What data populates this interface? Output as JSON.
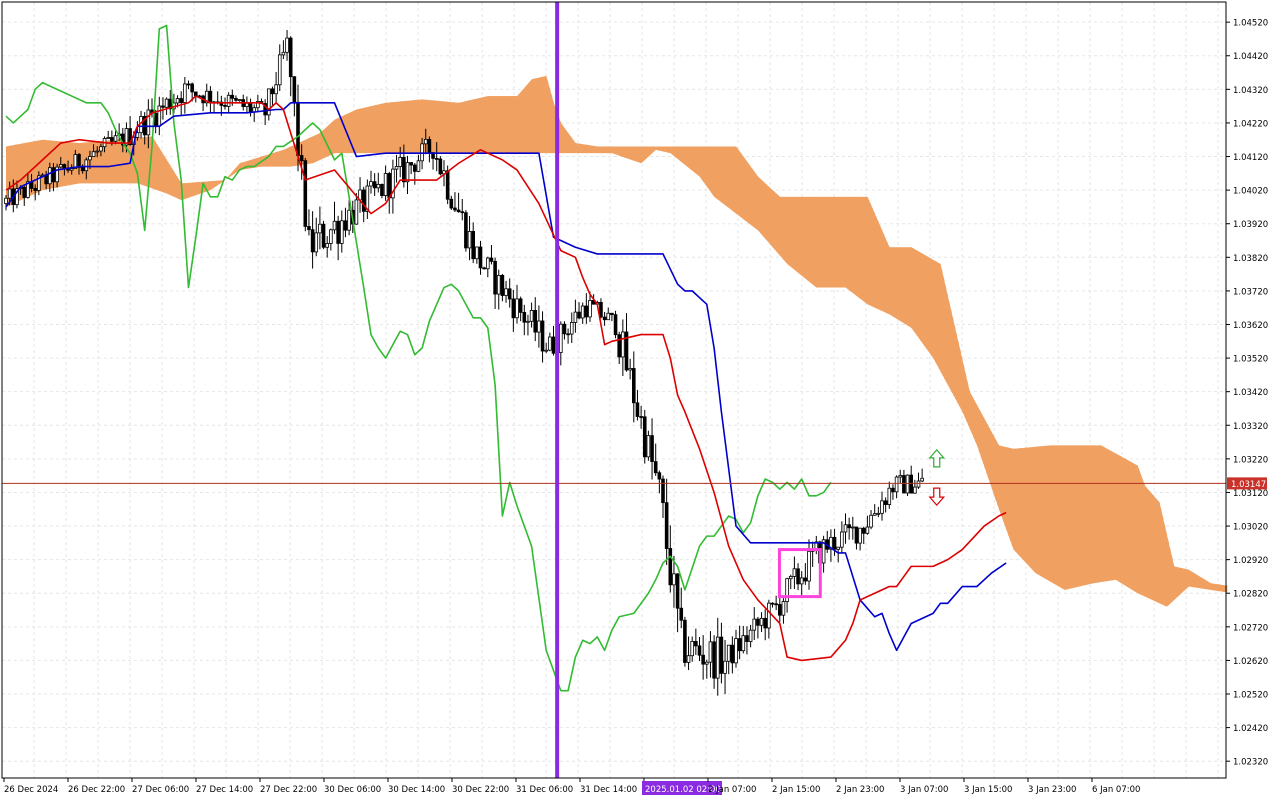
{
  "chart_data": {
    "type": "candlestick",
    "price_axis": {
      "range": [
        1.0227,
        1.0458
      ],
      "ticks": [
        "1.04520",
        "1.04420",
        "1.04320",
        "1.04220",
        "1.04120",
        "1.04020",
        "1.03920",
        "1.03820",
        "1.03720",
        "1.03620",
        "1.03520",
        "1.03420",
        "1.03320",
        "1.03220",
        "1.03120",
        "1.03020",
        "1.02920",
        "1.02820",
        "1.02720",
        "1.02620",
        "1.02520",
        "1.02420",
        "1.02320"
      ]
    },
    "time_axis": {
      "labels": [
        "26 Dec 2024",
        "26 Dec 22:00",
        "27 Dec 06:00",
        "27 Dec 14:00",
        "27 Dec 22:00",
        "30 Dec 06:00",
        "30 Dec 14:00",
        "30 Dec 22:00",
        "31 Dec 06:00",
        "31 Dec 14:00",
        "2025.01.02 02:00",
        "2 Jan 07:00",
        "2 Jan 15:00",
        "2 Jan 23:00",
        "3 Jan 07:00",
        "3 Jan 15:00",
        "3 Jan 23:00",
        "6 Jan 07:00"
      ],
      "highlighted_label": "2025.01.02 02:00"
    },
    "current_price": "1.03147",
    "grid": true,
    "colors": {
      "bull_body": "#ffffff",
      "bear_body": "#000000",
      "tenkan": "#dd0000",
      "kijun": "#0000cc",
      "chikou": "#33bb33",
      "kumo_up": "#f0a060",
      "kumo_down": "#d2bcd8",
      "current_line": "#b03020",
      "marker_line": "#8a2be2",
      "box": "#ff44dd",
      "arrow_up": "#33aa33",
      "arrow_down": "#dd0000"
    },
    "tenkan": [
      [
        0,
        1.0402
      ],
      [
        4,
        1.0405
      ],
      [
        10,
        1.0411
      ],
      [
        15,
        1.0416
      ],
      [
        20,
        1.0417
      ],
      [
        28,
        1.0416
      ],
      [
        34,
        1.0416
      ],
      [
        36,
        1.0421
      ],
      [
        40,
        1.0425
      ],
      [
        50,
        1.0428
      ],
      [
        52,
        1.043
      ],
      [
        56,
        1.0428
      ],
      [
        60,
        1.0428
      ],
      [
        70,
        1.0428
      ],
      [
        72,
        1.0426
      ],
      [
        74,
        1.0428
      ],
      [
        76,
        1.0426
      ],
      [
        82,
        1.0405
      ],
      [
        90,
        1.0408
      ],
      [
        100,
        1.0395
      ],
      [
        104,
        1.0398
      ],
      [
        108,
        1.0405
      ],
      [
        110,
        1.0405
      ],
      [
        118,
        1.0405
      ],
      [
        124,
        1.041
      ],
      [
        130,
        1.0414
      ],
      [
        136,
        1.0411
      ],
      [
        140,
        1.0408
      ],
      [
        146,
        1.0398
      ],
      [
        152,
        1.0384
      ],
      [
        156,
        1.0382
      ],
      [
        158,
        1.0376
      ],
      [
        160,
        1.0371
      ],
      [
        162,
        1.0368
      ],
      [
        164,
        1.0356
      ],
      [
        166,
        1.0357
      ],
      [
        170,
        1.0358
      ],
      [
        174,
        1.0359
      ],
      [
        180,
        1.0359
      ],
      [
        182,
        1.0352
      ],
      [
        184,
        1.0341
      ],
      [
        186,
        1.0336
      ],
      [
        190,
        1.0325
      ],
      [
        194,
        1.0312
      ],
      [
        198,
        1.0296
      ],
      [
        202,
        1.0286
      ],
      [
        206,
        1.028
      ],
      [
        212,
        1.0273
      ],
      [
        214,
        1.0263
      ],
      [
        218,
        1.0262
      ],
      [
        226,
        1.0263
      ],
      [
        230,
        1.0268
      ],
      [
        232,
        1.0273
      ],
      [
        234,
        1.028
      ],
      [
        238,
        1.0282
      ],
      [
        242,
        1.0284
      ],
      [
        244,
        1.0284
      ],
      [
        246,
        1.0287
      ],
      [
        248,
        1.029
      ],
      [
        254,
        1.029
      ],
      [
        258,
        1.0292
      ],
      [
        262,
        1.0295
      ],
      [
        268,
        1.0302
      ],
      [
        272,
        1.0305
      ],
      [
        274,
        1.0306
      ]
    ],
    "kijun": [
      [
        0,
        1.0397
      ],
      [
        4,
        1.0403
      ],
      [
        14,
        1.0408
      ],
      [
        20,
        1.0409
      ],
      [
        28,
        1.0409
      ],
      [
        34,
        1.041
      ],
      [
        36,
        1.0421
      ],
      [
        42,
        1.0421
      ],
      [
        46,
        1.0424
      ],
      [
        56,
        1.0425
      ],
      [
        66,
        1.0425
      ],
      [
        74,
        1.0426
      ],
      [
        76,
        1.0426
      ],
      [
        78,
        1.0428
      ],
      [
        84,
        1.0428
      ],
      [
        90,
        1.0428
      ],
      [
        96,
        1.0412
      ],
      [
        104,
        1.0413
      ],
      [
        116,
        1.0413
      ],
      [
        130,
        1.0413
      ],
      [
        138,
        1.0413
      ],
      [
        146,
        1.0413
      ],
      [
        150,
        1.0388
      ],
      [
        156,
        1.0385
      ],
      [
        162,
        1.0383
      ],
      [
        168,
        1.0383
      ],
      [
        176,
        1.0383
      ],
      [
        178,
        1.0383
      ],
      [
        180,
        1.0383
      ],
      [
        184,
        1.0374
      ],
      [
        186,
        1.0372
      ],
      [
        188,
        1.0372
      ],
      [
        192,
        1.0368
      ],
      [
        194,
        1.0355
      ],
      [
        196,
        1.0336
      ],
      [
        198,
        1.0319
      ],
      [
        200,
        1.0302
      ],
      [
        204,
        1.0297
      ],
      [
        214,
        1.0297
      ],
      [
        224,
        1.0297
      ],
      [
        228,
        1.0294
      ],
      [
        230,
        1.0294
      ],
      [
        234,
        1.028
      ],
      [
        238,
        1.0275
      ],
      [
        240,
        1.0276
      ],
      [
        242,
        1.027
      ],
      [
        244,
        1.0265
      ],
      [
        248,
        1.0273
      ],
      [
        254,
        1.0276
      ],
      [
        256,
        1.0279
      ],
      [
        258,
        1.0279
      ],
      [
        262,
        1.0284
      ],
      [
        266,
        1.0284
      ],
      [
        270,
        1.0288
      ],
      [
        274,
        1.0291
      ]
    ],
    "chikou": [
      [
        0,
        1.0424
      ],
      [
        2,
        1.0422
      ],
      [
        6,
        1.0426
      ],
      [
        8,
        1.0432
      ],
      [
        10,
        1.0434
      ],
      [
        14,
        1.0432
      ],
      [
        18,
        1.043
      ],
      [
        22,
        1.0428
      ],
      [
        26,
        1.0428
      ],
      [
        28,
        1.0425
      ],
      [
        30,
        1.042
      ],
      [
        32,
        1.0416
      ],
      [
        34,
        1.0413
      ],
      [
        36,
        1.0407
      ],
      [
        38,
        1.039
      ],
      [
        40,
        1.0415
      ],
      [
        42,
        1.045
      ],
      [
        44,
        1.0451
      ],
      [
        46,
        1.0422
      ],
      [
        48,
        1.0405
      ],
      [
        50,
        1.0373
      ],
      [
        52,
        1.0388
      ],
      [
        54,
        1.0404
      ],
      [
        56,
        1.04
      ],
      [
        58,
        1.04
      ],
      [
        60,
        1.0406
      ],
      [
        62,
        1.0405
      ],
      [
        64,
        1.0408
      ],
      [
        66,
        1.0409
      ],
      [
        68,
        1.0409
      ],
      [
        72,
        1.0412
      ],
      [
        74,
        1.0415
      ],
      [
        76,
        1.0415
      ],
      [
        80,
        1.0418
      ],
      [
        84,
        1.0422
      ],
      [
        86,
        1.042
      ],
      [
        90,
        1.0411
      ],
      [
        92,
        1.0413
      ],
      [
        94,
        1.04
      ],
      [
        98,
        1.0373
      ],
      [
        100,
        1.0359
      ],
      [
        102,
        1.0355
      ],
      [
        104,
        1.0352
      ],
      [
        106,
        1.0356
      ],
      [
        108,
        1.036
      ],
      [
        110,
        1.0359
      ],
      [
        112,
        1.0353
      ],
      [
        114,
        1.0355
      ],
      [
        116,
        1.0363
      ],
      [
        118,
        1.0368
      ],
      [
        120,
        1.0373
      ],
      [
        122,
        1.0374
      ],
      [
        124,
        1.0372
      ],
      [
        126,
        1.0368
      ],
      [
        128,
        1.0364
      ],
      [
        130,
        1.0364
      ],
      [
        132,
        1.0361
      ],
      [
        134,
        1.0344
      ],
      [
        136,
        1.0305
      ],
      [
        138,
        1.0315
      ],
      [
        140,
        1.0308
      ],
      [
        144,
        1.0296
      ],
      [
        148,
        1.0265
      ],
      [
        152,
        1.0253
      ],
      [
        154,
        1.0253
      ],
      [
        156,
        1.0263
      ],
      [
        158,
        1.0268
      ],
      [
        160,
        1.0267
      ],
      [
        162,
        1.0269
      ],
      [
        164,
        1.0265
      ],
      [
        166,
        1.0271
      ],
      [
        168,
        1.0275
      ],
      [
        172,
        1.0276
      ],
      [
        176,
        1.0282
      ],
      [
        178,
        1.0286
      ],
      [
        180,
        1.0291
      ],
      [
        182,
        1.0293
      ],
      [
        184,
        1.029
      ],
      [
        186,
        1.0283
      ],
      [
        190,
        1.0296
      ],
      [
        192,
        1.0299
      ],
      [
        194,
        1.0299
      ],
      [
        196,
        1.0302
      ],
      [
        198,
        1.0305
      ],
      [
        200,
        1.0304
      ],
      [
        202,
        1.03
      ],
      [
        204,
        1.0303
      ],
      [
        206,
        1.0311
      ],
      [
        208,
        1.0316
      ],
      [
        210,
        1.0315
      ],
      [
        212,
        1.0313
      ],
      [
        214,
        1.0315
      ],
      [
        216,
        1.0313
      ],
      [
        218,
        1.0316
      ],
      [
        220,
        1.0311
      ],
      [
        222,
        1.0311
      ],
      [
        224,
        1.0312
      ],
      [
        226,
        1.0315
      ]
    ],
    "kumo_a": [
      [
        0,
        1.0415
      ],
      [
        10,
        1.0417
      ],
      [
        20,
        1.0416
      ],
      [
        40,
        1.0418
      ],
      [
        48,
        1.0404
      ],
      [
        60,
        1.0405
      ],
      [
        64,
        1.041
      ],
      [
        76,
        1.0414
      ],
      [
        80,
        1.0416
      ],
      [
        86,
        1.0419
      ],
      [
        90,
        1.0423
      ],
      [
        96,
        1.0426
      ],
      [
        104,
        1.0428
      ],
      [
        114,
        1.0429
      ],
      [
        124,
        1.0428
      ],
      [
        132,
        1.043
      ],
      [
        140,
        1.043
      ],
      [
        144,
        1.0435
      ],
      [
        148,
        1.0436
      ],
      [
        150,
        1.0428
      ],
      [
        152,
        1.0422
      ],
      [
        156,
        1.0416
      ],
      [
        162,
        1.0415
      ],
      [
        166,
        1.0415
      ],
      [
        174,
        1.0415
      ],
      [
        184,
        1.0415
      ],
      [
        192,
        1.0415
      ],
      [
        200,
        1.0415
      ],
      [
        206,
        1.0406
      ],
      [
        212,
        1.04
      ],
      [
        216,
        1.04
      ],
      [
        226,
        1.04
      ],
      [
        236,
        1.04
      ],
      [
        242,
        1.0385
      ],
      [
        248,
        1.0385
      ],
      [
        256,
        1.038
      ],
      [
        264,
        1.0342
      ],
      [
        272,
        1.0326
      ],
      [
        276,
        1.0325
      ],
      [
        286,
        1.0326
      ],
      [
        300,
        1.0326
      ],
      [
        310,
        1.032
      ],
      [
        312,
        1.0314
      ],
      [
        316,
        1.0309
      ],
      [
        320,
        1.029
      ],
      [
        324,
        1.0289
      ],
      [
        330,
        1.0285
      ],
      [
        336,
        1.0284
      ]
    ],
    "kumo_b": [
      [
        0,
        1.0397
      ],
      [
        10,
        1.0402
      ],
      [
        20,
        1.0404
      ],
      [
        36,
        1.0404
      ],
      [
        44,
        1.0401
      ],
      [
        48,
        1.0399
      ],
      [
        56,
        1.0402
      ],
      [
        60,
        1.0405
      ],
      [
        64,
        1.0408
      ],
      [
        70,
        1.0409
      ],
      [
        78,
        1.0409
      ],
      [
        84,
        1.041
      ],
      [
        90,
        1.0413
      ],
      [
        100,
        1.0413
      ],
      [
        116,
        1.0413
      ],
      [
        124,
        1.0413
      ],
      [
        130,
        1.0413
      ],
      [
        140,
        1.0413
      ],
      [
        146,
        1.0413
      ],
      [
        150,
        1.0413
      ],
      [
        156,
        1.0413
      ],
      [
        160,
        1.0413
      ],
      [
        166,
        1.0413
      ],
      [
        174,
        1.041
      ],
      [
        178,
        1.0414
      ],
      [
        182,
        1.0413
      ],
      [
        190,
        1.0406
      ],
      [
        194,
        1.04
      ],
      [
        200,
        1.0395
      ],
      [
        206,
        1.039
      ],
      [
        214,
        1.038
      ],
      [
        222,
        1.0373
      ],
      [
        230,
        1.0373
      ],
      [
        236,
        1.0368
      ],
      [
        242,
        1.0365
      ],
      [
        248,
        1.0361
      ],
      [
        254,
        1.0352
      ],
      [
        258,
        1.0344
      ],
      [
        262,
        1.0336
      ],
      [
        266,
        1.0326
      ],
      [
        272,
        1.0307
      ],
      [
        276,
        1.0295
      ],
      [
        282,
        1.0288
      ],
      [
        290,
        1.0283
      ],
      [
        298,
        1.0285
      ],
      [
        304,
        1.0286
      ],
      [
        310,
        1.0282
      ],
      [
        314,
        1.028
      ],
      [
        318,
        1.0278
      ],
      [
        324,
        1.0284
      ],
      [
        330,
        1.0283
      ],
      [
        336,
        1.0282
      ]
    ],
    "segments": [
      {
        "from": 0,
        "to": 34,
        "start": 1.0398,
        "end": 1.0418,
        "vol": 0.0004
      },
      {
        "from": 34,
        "to": 50,
        "start": 1.0418,
        "end": 1.0432,
        "vol": 0.0005
      },
      {
        "from": 50,
        "to": 72,
        "start": 1.0432,
        "end": 1.0425,
        "vol": 0.0004
      },
      {
        "from": 72,
        "to": 78,
        "start": 1.0425,
        "end": 1.0445,
        "vol": 0.0005
      },
      {
        "from": 78,
        "to": 84,
        "start": 1.0445,
        "end": 1.0385,
        "vol": 0.0008
      },
      {
        "from": 84,
        "to": 92,
        "start": 1.0385,
        "end": 1.0392,
        "vol": 0.0008
      },
      {
        "from": 92,
        "to": 110,
        "start": 1.0392,
        "end": 1.0408,
        "vol": 0.0006
      },
      {
        "from": 110,
        "to": 118,
        "start": 1.0408,
        "end": 1.0415,
        "vol": 0.0005
      },
      {
        "from": 118,
        "to": 130,
        "start": 1.0415,
        "end": 1.0382,
        "vol": 0.0007
      },
      {
        "from": 130,
        "to": 150,
        "start": 1.0382,
        "end": 1.0355,
        "vol": 0.0006
      },
      {
        "from": 150,
        "to": 160,
        "start": 1.0355,
        "end": 1.0368,
        "vol": 0.0005
      },
      {
        "from": 160,
        "to": 168,
        "start": 1.0368,
        "end": 1.0362,
        "vol": 0.0004
      },
      {
        "from": 168,
        "to": 180,
        "start": 1.0362,
        "end": 1.0312,
        "vol": 0.0008
      },
      {
        "from": 180,
        "to": 186,
        "start": 1.0312,
        "end": 1.0266,
        "vol": 0.001
      },
      {
        "from": 186,
        "to": 198,
        "start": 1.0266,
        "end": 1.0262,
        "vol": 0.0008
      },
      {
        "from": 198,
        "to": 212,
        "start": 1.0262,
        "end": 1.0278,
        "vol": 0.0005
      },
      {
        "from": 212,
        "to": 224,
        "start": 1.0278,
        "end": 1.0295,
        "vol": 0.0006
      },
      {
        "from": 224,
        "to": 236,
        "start": 1.0295,
        "end": 1.0302,
        "vol": 0.0005
      },
      {
        "from": 236,
        "to": 244,
        "start": 1.0302,
        "end": 1.0314,
        "vol": 0.0005
      },
      {
        "from": 244,
        "to": 252,
        "start": 1.0314,
        "end": 1.0315,
        "vol": 0.0004
      }
    ],
    "n_bars": 252,
    "marker_bar": 151,
    "highlight_box": {
      "bar_from": 213,
      "bar_to": 222,
      "price_low": 1.0281,
      "price_high": 1.0295
    },
    "signals": {
      "bar": 255,
      "up_price": 1.0322,
      "down_price": 1.0313
    }
  }
}
